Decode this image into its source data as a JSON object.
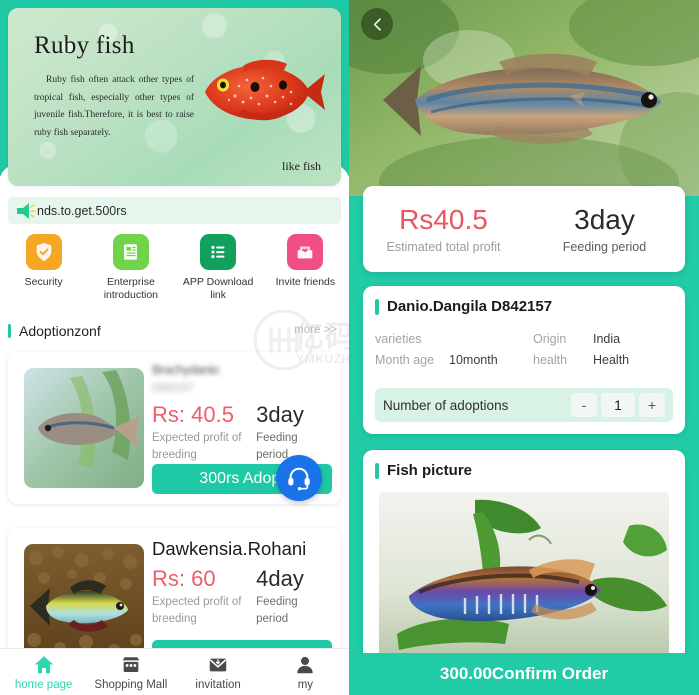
{
  "colors": {
    "teal": "#20c9a5",
    "price_red": "#ef5c6a",
    "profit_red": "#e8565f",
    "fab_blue": "#1a73e8",
    "muted": "#9a9a9a"
  },
  "left": {
    "banner": {
      "title": "Ruby fish",
      "body": "Ruby fish often attack other types of tropical fish,  especially other types of juvenile fish.Therefore, it is best to raise ruby fish separately.",
      "caption": "like fish"
    },
    "notice": {
      "text": "nds.to.get.500rs",
      "icon": "megaphone-icon"
    },
    "quick_links": [
      {
        "label": "Security",
        "icon": "shield-check-icon",
        "color": "#f5a623"
      },
      {
        "label": "Enterprise introduction",
        "icon": "document-icon",
        "color": "#6fd44a"
      },
      {
        "label": "APP Download link",
        "icon": "list-icon",
        "color": "#13a05c"
      },
      {
        "label": "Invite friends",
        "icon": "gift-heart-icon",
        "color": "#ef4f86"
      }
    ],
    "section": {
      "title": "Adoptionzonf",
      "more": "more >>"
    },
    "watermark": {
      "cn": "亿码酷站",
      "en": "YMKUZHAN.COM"
    },
    "cards": [
      {
        "title": "Brachydanio",
        "subtitle": "D842157",
        "price": "Rs: 40.5",
        "price_caption": "Expected profit of breeding",
        "period": "3day",
        "period_caption": "Feeding period",
        "button": "300rs Adopt",
        "blurred": true
      },
      {
        "title": "Dawkensia.Rohani",
        "subtitle": "",
        "price": "Rs: 60",
        "price_caption": "Expected profit of breeding",
        "period": "4day",
        "period_caption": "Feeding period",
        "button": "",
        "blurred": false
      }
    ],
    "service_button": {
      "icon": "headset-icon"
    },
    "tabs": [
      {
        "label": "home page",
        "icon": "home-icon",
        "active": true
      },
      {
        "label": "Shopping Mall",
        "icon": "store-icon",
        "active": false
      },
      {
        "label": "invitation",
        "icon": "envelope-icon",
        "active": false
      },
      {
        "label": "my",
        "icon": "person-icon",
        "active": false
      }
    ]
  },
  "right": {
    "back": {
      "icon": "chevron-left-icon"
    },
    "profit": {
      "amount": "Rs40.5",
      "amount_caption": "Estimated total profit",
      "period": "3day",
      "period_caption": "Feeding period"
    },
    "detail": {
      "title": "Danio.Dangila  D842157",
      "rows": [
        {
          "key": "varieties",
          "value": "",
          "key2": "Origin",
          "value2": "India"
        },
        {
          "key": "Month age",
          "value": "10month",
          "key2": "health",
          "value2": "Health"
        }
      ],
      "qty_label": "Number of adoptions",
      "qty_minus": "-",
      "qty_value": "1",
      "qty_plus": "+"
    },
    "picture": {
      "title": "Fish picture"
    },
    "confirm": {
      "label": "300.00Confirm Order"
    }
  }
}
